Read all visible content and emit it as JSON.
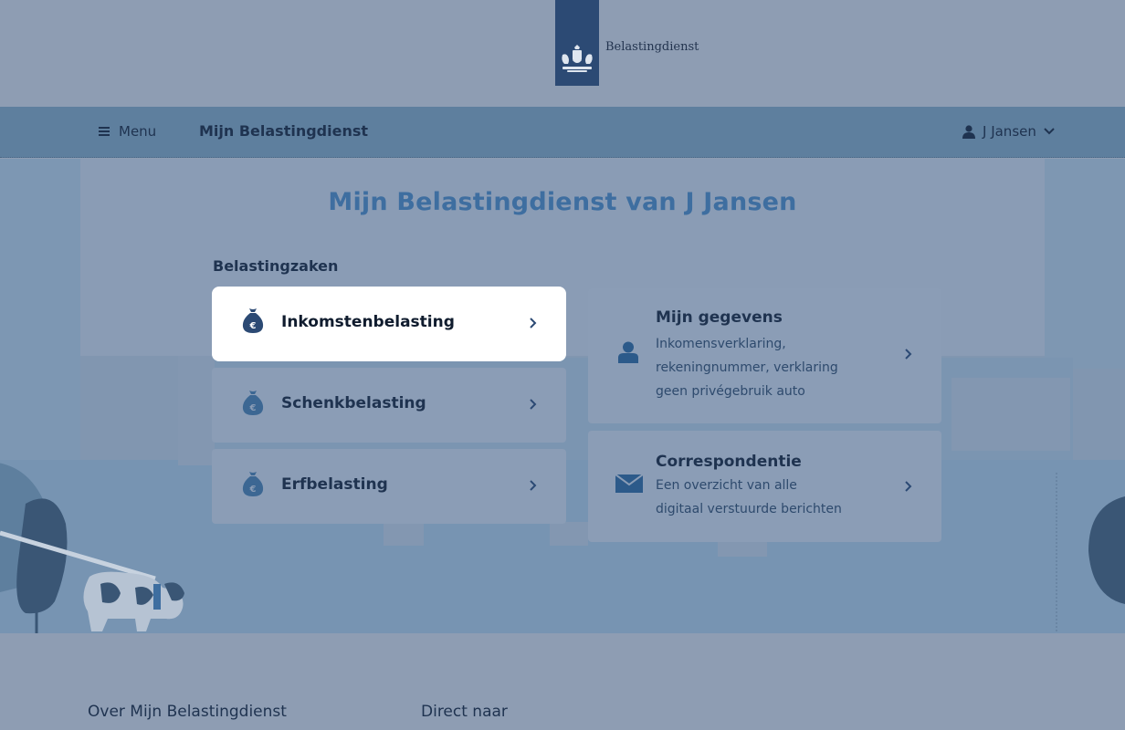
{
  "header": {
    "logo_text": "Belastingdienst",
    "logo_icon": "royal-coat-of-arms-icon"
  },
  "navbar": {
    "menu_label": "Menu",
    "title": "Mijn Belastingdienst",
    "user_name": "J Jansen"
  },
  "main": {
    "title": "Mijn Belastingdienst van J Jansen",
    "section_heading": "Belastingzaken",
    "tax_tiles": [
      {
        "label": "Inkomstenbelasting",
        "icon": "money-bag-euro-icon",
        "active": true
      },
      {
        "label": "Schenkbelasting",
        "icon": "money-bag-euro-icon",
        "active": false
      },
      {
        "label": "Erfbelasting",
        "icon": "money-bag-euro-icon",
        "active": false
      }
    ],
    "info_tiles": [
      {
        "title": "Mijn gegevens",
        "description": "Inkomensverklaring, rekeningnummer, verklaring geen privégebruik auto",
        "icon": "person-icon"
      },
      {
        "title": "Correspondentie",
        "description": "Een overzicht van alle digitaal verstuurde berichten",
        "icon": "envelope-icon"
      }
    ]
  },
  "footer": {
    "col1_heading": "Over Mijn Belastingdienst",
    "col2_heading": "Direct naar"
  },
  "colors": {
    "accent": "#3e6ea0",
    "navbar": "#5e7f9e",
    "logo_block": "#2c4a74",
    "overlay": "#8e9db3"
  }
}
